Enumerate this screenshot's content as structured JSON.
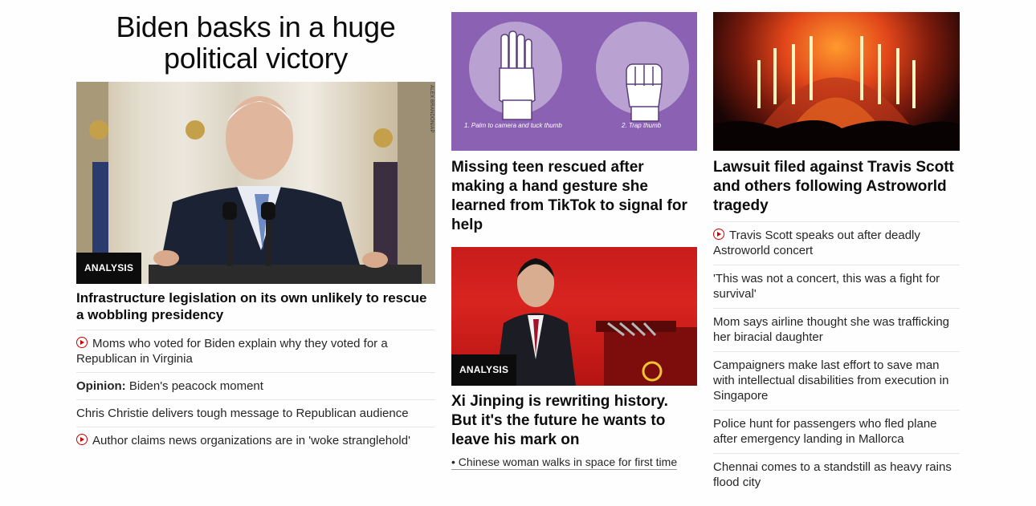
{
  "left": {
    "headline": "Biden basks in a huge political victory",
    "photo_credit": "ALEX BRANDON/AP",
    "badge": "ANALYSIS",
    "lead_title": "Infrastructure legislation on its own unlikely to rescue a wobbling presidency",
    "related": [
      {
        "text": "Moms who voted for Biden explain why they voted for a Republican in Virginia",
        "video": true
      },
      {
        "label": "Opinion:",
        "text": " Biden's peacock moment"
      },
      {
        "text": "Chris Christie delivers tough message to Republican audience"
      },
      {
        "text": "Author claims news organizations are in 'woke stranglehold'",
        "video": true
      }
    ]
  },
  "middle": {
    "hand_captions": [
      "1. Palm to camera and tuck thumb",
      "2. Trap thumb"
    ],
    "teen_title": "Missing teen rescued after making a hand gesture she learned from TikTok to signal for help",
    "xi_badge": "ANALYSIS",
    "xi_title": "Xi Jinping is rewriting history. But it's the future he wants to leave his mark on",
    "xi_sub": "• Chinese woman walks in space for first time"
  },
  "right": {
    "title": "Lawsuit filed against Travis Scott and others following Astroworld tragedy",
    "related": [
      "Travis Scott speaks out after deadly Astroworld concert",
      "'This was not a concert, this was a fight for survival'",
      "Mom says airline thought she was trafficking her biracial daughter",
      "Campaigners make last effort to save man with intellectual disabilities from execution in Singapore",
      "Police hunt for passengers who fled plane after emergency landing in Mallorca",
      "Chennai comes to a standstill as heavy rains flood city"
    ]
  },
  "colors": {
    "badge_bg": "#0c0c0c",
    "video_icon": "#cc0000",
    "hand_bg": "#8b61b4"
  },
  "icons": [
    "play-video-icon"
  ]
}
